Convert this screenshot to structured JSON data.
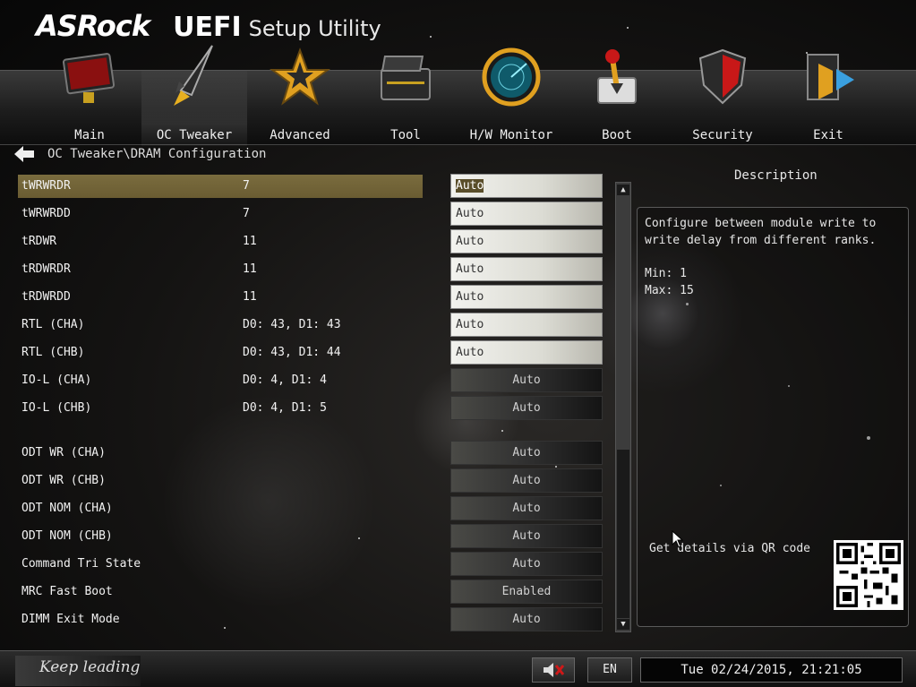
{
  "header": {
    "logo": "ASRock",
    "uefi": "UEFI",
    "subtitle": "Setup Utility"
  },
  "nav": {
    "tabs": [
      {
        "label": "Main",
        "icon": "monitor-icon",
        "active": false
      },
      {
        "label": "OC Tweaker",
        "icon": "rocket-icon",
        "active": true
      },
      {
        "label": "Advanced",
        "icon": "star-icon",
        "active": false
      },
      {
        "label": "Tool",
        "icon": "toolbox-icon",
        "active": false
      },
      {
        "label": "H/W Monitor",
        "icon": "radar-icon",
        "active": false
      },
      {
        "label": "Boot",
        "icon": "joystick-icon",
        "active": false
      },
      {
        "label": "Security",
        "icon": "shield-icon",
        "active": false
      },
      {
        "label": "Exit",
        "icon": "exit-door-icon",
        "active": false
      }
    ]
  },
  "breadcrumb": "OC Tweaker\\DRAM Configuration",
  "settings": [
    {
      "label": "tWRWRDR",
      "value": "7",
      "option": "Auto"
    },
    {
      "label": "tWRWRDD",
      "value": "7",
      "option": "Auto"
    },
    {
      "label": "tRDWR",
      "value": "11",
      "option": "Auto"
    },
    {
      "label": "tRDWRDR",
      "value": "11",
      "option": "Auto"
    },
    {
      "label": "tRDWRDD",
      "value": "11",
      "option": "Auto"
    },
    {
      "label": "RTL (CHA)",
      "value": "D0: 43, D1: 43",
      "option": "Auto"
    },
    {
      "label": "RTL (CHB)",
      "value": "D0: 43, D1: 44",
      "option": "Auto"
    },
    {
      "label": "IO-L (CHA)",
      "value": "D0: 4, D1: 4",
      "option": "Auto"
    },
    {
      "label": "IO-L (CHB)",
      "value": "D0: 4, D1: 5",
      "option": "Auto"
    },
    {
      "label": "ODT WR (CHA)",
      "value": "",
      "option": "Auto"
    },
    {
      "label": "ODT WR (CHB)",
      "value": "",
      "option": "Auto"
    },
    {
      "label": "ODT NOM (CHA)",
      "value": "",
      "option": "Auto"
    },
    {
      "label": "ODT NOM (CHB)",
      "value": "",
      "option": "Auto"
    },
    {
      "label": "Command Tri State",
      "value": "",
      "option": "Auto"
    },
    {
      "label": "MRC Fast Boot",
      "value": "",
      "option": "Enabled"
    },
    {
      "label": "DIMM Exit Mode",
      "value": "",
      "option": "Auto"
    }
  ],
  "description": {
    "title": "Description",
    "text": "Configure between module write to write delay from different ranks.",
    "min": "Min: 1",
    "max": "Max: 15",
    "qr_text": "Get details via QR code"
  },
  "footer": {
    "slogan": "Keep leading",
    "language": "EN",
    "datetime": "Tue 02/24/2015, 21:21:05"
  },
  "colors": {
    "selected_row": "#7a6c3e",
    "background": "#141312"
  }
}
